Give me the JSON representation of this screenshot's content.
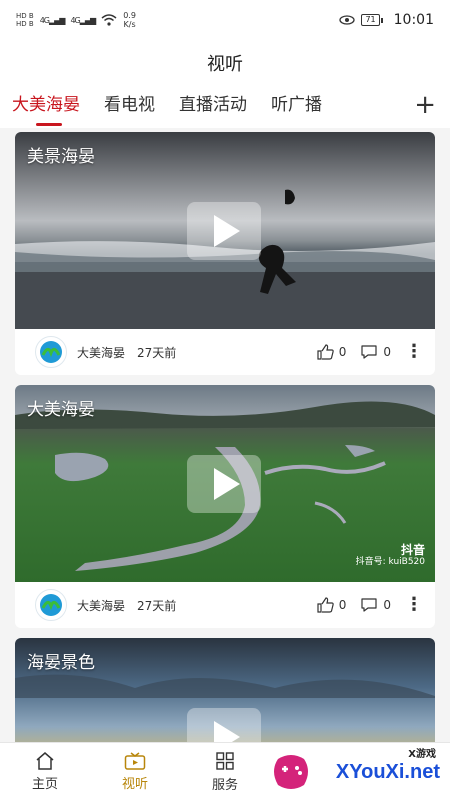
{
  "status": {
    "hd1": "HD B",
    "hd2": "HD B",
    "net1": "4G",
    "net2": "4G",
    "speed_value": "0.9",
    "speed_unit": "K/s",
    "battery": "71",
    "time": "10:01"
  },
  "header": {
    "title": "视听"
  },
  "tabs": [
    {
      "label": "大美海晏"
    },
    {
      "label": "看电视"
    },
    {
      "label": "直播活动"
    },
    {
      "label": "听广播"
    }
  ],
  "cards": [
    {
      "title": "美景海晏",
      "source": "大美海晏",
      "time": "27天前",
      "likes": "0",
      "comments": "0"
    },
    {
      "title": "大美海晏",
      "source": "大美海晏",
      "time": "27天前",
      "likes": "0",
      "comments": "0",
      "wm_brand": "抖音",
      "wm_id": "抖音号: kuiB520"
    },
    {
      "title": "海晏景色"
    }
  ],
  "nav": [
    {
      "label": "主页",
      "icon": "home-icon"
    },
    {
      "label": "视听",
      "icon": "tv-icon"
    },
    {
      "label": "服务",
      "icon": "grid-icon"
    }
  ],
  "overlay": {
    "site": "XYouXi.net",
    "tag": "X游戏"
  },
  "colors": {
    "accent": "#c8161e",
    "nav_active": "#b8860b"
  }
}
